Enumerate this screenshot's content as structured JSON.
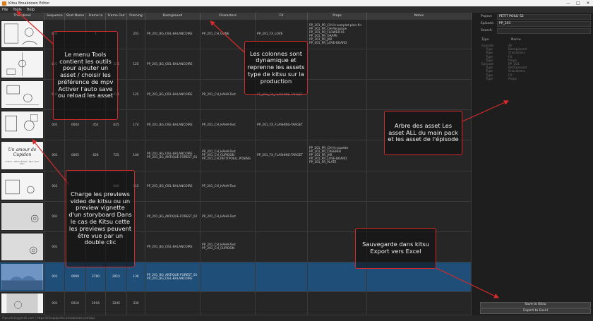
{
  "window": {
    "title": "Kitsu Breakdown Editor",
    "controls": [
      "—",
      "□",
      "✕"
    ]
  },
  "menu": [
    "File",
    "Tools",
    "Help"
  ],
  "columns": [
    "Thumbnail",
    "Sequence",
    "Shot Name",
    "Frame In",
    "Frame Out",
    "Framing",
    "Background",
    "Characters",
    "FX",
    "Props",
    "Notes"
  ],
  "rows": [
    {
      "sequence": "001",
      "shot": "",
      "frame_in": "1",
      "frame_out": "",
      "framing": "201",
      "background": [
        "PP_201_BG_CIEL-BALANCOIRE"
      ],
      "characters": [
        "PP_201_CH_GUNE"
      ],
      "fx": [
        "PP_201_FX_LOVE"
      ],
      "props": [
        "PP_201_PR_CH-lit-complet-plan-fin",
        "PP_201_PR_CH-Parapluie",
        "PP_201_PR_FLOWER-01",
        "PP_201_PR_GRAPE",
        "PP_201_PR_JAR",
        "PP_201_PR_LOVE-BOARD"
      ]
    },
    {
      "sequence": "001",
      "shot": "",
      "frame_in": "",
      "frame_out": "326",
      "framing": "125",
      "background": [
        "PP_201_BG_CIEL-BALANCOIRE"
      ],
      "characters": [],
      "fx": [],
      "props": []
    },
    {
      "sequence": "001",
      "shot": "",
      "frame_in": "",
      "frame_out": "451",
      "framing": "125",
      "background": [
        "PP_201_BG_CIEL-BALANCOIRE"
      ],
      "characters": [
        "PP_201_CH_HAHA-Test"
      ],
      "fx": [
        "PP_201_FX_FLASHING-TARGET"
      ],
      "props": []
    },
    {
      "sequence": "001",
      "shot": "0004",
      "frame_in": "452",
      "frame_out": "625",
      "framing": "174",
      "background": [
        "PP_201_BG_CIEL-BALANCOIRE"
      ],
      "characters": [
        "PP_201_CH_HAHA-Test"
      ],
      "fx": [
        "PP_201_FX_FLASHING-TARGET"
      ],
      "props": []
    },
    {
      "sequence": "001",
      "shot": "0005",
      "frame_in": "626",
      "frame_out": "725",
      "framing": "100",
      "background": [
        "PP_201_BG_CIEL-BALANCOIRE",
        "PP_201_BG_ANTIQUE-FOREST_01"
      ],
      "characters": [
        "PP_201_CH_HAHA-Test",
        "PP_201_CH_CUPIDON",
        "PP_201_CH_PETITPOILU_POSING"
      ],
      "fx": [
        "PP_201_FX_FLASHING-TARGET"
      ],
      "props": [
        "PP_201_PR_CH-lit-couette",
        "PP_201_PR_CREEPER",
        "PP_201_PR_JAR",
        "PP_201_PR_LOVE-BOARD",
        "PP_201_PR_PLATE"
      ]
    },
    {
      "sequence": "001",
      "shot": "",
      "frame_in": "",
      "frame_out": "840",
      "framing": "115",
      "background": [
        "PP_201_BG_CIEL-BALANCOIRE"
      ],
      "characters": [
        "PP_201_CH_HAHA-Test"
      ],
      "fx": [],
      "props": []
    },
    {
      "sequence": "001",
      "shot": "",
      "frame_in": "",
      "frame_out": "",
      "framing": "",
      "background": [
        "PP_201_BG_ANTIQUE-FOREST_02"
      ],
      "characters": [
        "PP_201_CH_HAHA-Test"
      ],
      "fx": [],
      "props": []
    },
    {
      "sequence": "001",
      "shot": "",
      "frame_in": "",
      "frame_out": "",
      "framing": "",
      "background": [
        "PP_201_BG_CIEL-BALANCOIRE"
      ],
      "characters": [
        "PP_201_CH_HAHA-Test",
        "PP_201_CH_CUPIDON"
      ],
      "fx": [],
      "props": []
    },
    {
      "sequence": "001",
      "shot": "0009",
      "frame_in": "2780",
      "frame_out": "2915",
      "framing": "136",
      "background": [
        "PP_201_BG_ANTIQUE-FOREST_01",
        "PP_201_BG_CIEL-BALANCOIRE"
      ],
      "characters": [],
      "fx": [],
      "props": [],
      "selected": true
    },
    {
      "sequence": "001",
      "shot": "0010",
      "frame_in": "2916",
      "frame_out": "3245",
      "framing": "330",
      "background": [],
      "characters": [],
      "fx": [],
      "props": []
    }
  ],
  "side": {
    "project_label": "Project",
    "project_value": "PETIT POILU S2",
    "episode_label": "Episode",
    "episode_value": "PP_201",
    "search_label": "Search",
    "tree_col_type": "Type",
    "tree_col_name": "Name",
    "tree": [
      {
        "type": "Episode",
        "name": "All",
        "level": 0
      },
      {
        "type": "Type",
        "name": "Background",
        "level": 1
      },
      {
        "type": "Type",
        "name": "Characters",
        "level": 1
      },
      {
        "type": "Type",
        "name": "FX",
        "level": 1
      },
      {
        "type": "Type",
        "name": "Props",
        "level": 1
      },
      {
        "type": "Episode",
        "name": "PP_201",
        "level": 0
      },
      {
        "type": "Type",
        "name": "Background",
        "level": 1
      },
      {
        "type": "Type",
        "name": "Characters",
        "level": 1
      },
      {
        "type": "Type",
        "name": "FX",
        "level": 1
      },
      {
        "type": "Type",
        "name": "Props",
        "level": 1
      }
    ]
  },
  "buttons": {
    "save": "Save to Kitsu",
    "export": "Export to Excel"
  },
  "status": "lhpcurtain@gmail.com | https://kitsupipeline.amazonaws.com/api",
  "thumb_texts": {
    "cupidon_title": "Un amour de Cupidon",
    "cupidon_credits": "Auteurs : Hélène Bruller · Réal : Jean-Marc"
  },
  "annotations": {
    "tools": "Le menu Tools contient les outils pour ajouter un asset / choisir les préférence de mpv Activer l'auto save ou reload les asset",
    "columns": "Les colonnes sont dynamique et reprenne les assets type de kitsu sur la production",
    "tree": "Arbre des asset Les asset ALL du main pack et les asset de l'épisode",
    "previews": "Charge les previews video de kitsu ou un preview vignette d'un storyboard Dans le cas de Kitsu cette les previews peuvent être vue par un double clic",
    "save": "Sauvegarde dans kitsu Export vers Excel"
  },
  "colors": {
    "accent": "#1f4e79",
    "annotation": "#d42a2a"
  }
}
